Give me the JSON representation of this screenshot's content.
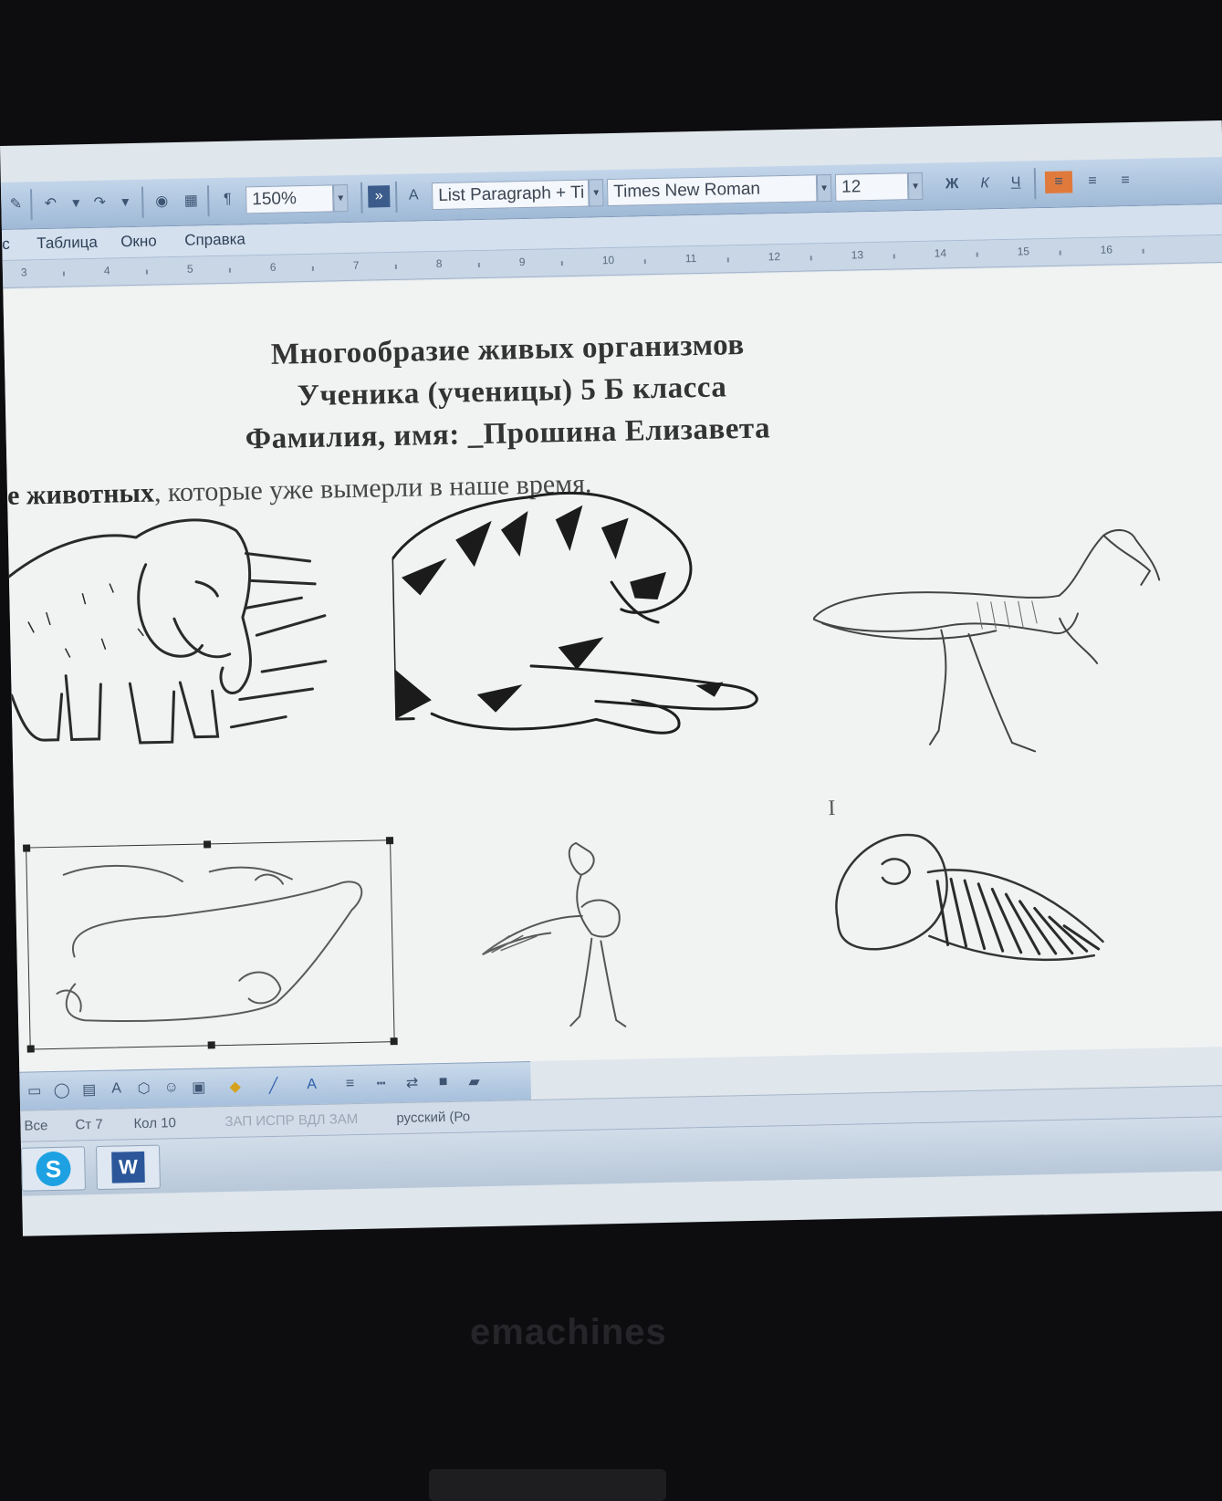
{
  "toolbar": {
    "zoom": "150%",
    "style": "List Paragraph + Ti",
    "font": "Times New Roman",
    "font_size": "12",
    "bold": "Ж",
    "italic": "К",
    "underline": "Ч"
  },
  "menu": [
    "с",
    "Таблица",
    "Окно",
    "Справка"
  ],
  "ruler": [
    "3",
    "4",
    "5",
    "6",
    "7",
    "8",
    "9",
    "10",
    "11",
    "12",
    "13",
    "14",
    "15",
    "16"
  ],
  "document": {
    "title": "Многообразие живых организмов",
    "line2": "Ученика (ученицы) 5 Б  класса",
    "line3": "Фамилия, имя: _Прошина Елизавета",
    "intro_bold": "е животных",
    "intro_rest": ", которые уже вымерли в наше время."
  },
  "status": {
    "page": "Все",
    "line": "Ст 7",
    "col": "Кол 10",
    "modes": "ЗАП  ИСПР  ВДЛ  ЗАМ",
    "language": "русский (Ро"
  },
  "brand": "emachines",
  "colors": {
    "toolbar": "#b3c8e0",
    "document": "#f1f3f3",
    "bezel": "#0d0d10"
  }
}
